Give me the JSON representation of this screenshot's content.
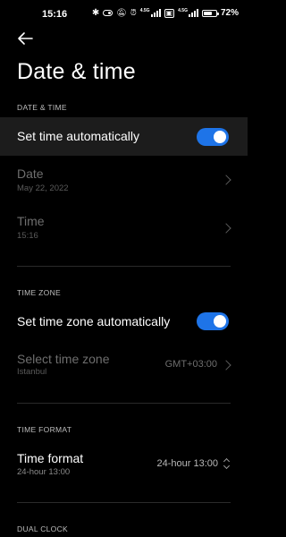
{
  "status_bar": {
    "time": "15:16",
    "network_label": "4.5G",
    "network_label2": "4.5G",
    "wifi_label": "WiFi",
    "battery_text": "72",
    "battery_level": 0.72
  },
  "header": {
    "title": "Date & time"
  },
  "date_time": {
    "section_label": "DATE & TIME",
    "set_automatically": {
      "label": "Set time automatically",
      "enabled": true
    },
    "date": {
      "label": "Date",
      "value": "May 22, 2022"
    },
    "time": {
      "label": "Time",
      "value": "15:16"
    }
  },
  "time_zone": {
    "section_label": "TIME ZONE",
    "set_automatically": {
      "label": "Set time zone automatically",
      "enabled": true
    },
    "select": {
      "label": "Select time zone",
      "sub": "Istanbul",
      "value": "GMT+03:00"
    }
  },
  "time_format": {
    "section_label": "TIME FORMAT",
    "row": {
      "label": "Time format",
      "sub": "24-hour 13:00",
      "value": "24-hour 13:00"
    }
  },
  "dual_clock": {
    "section_label": "DUAL CLOCK"
  },
  "colors": {
    "accent": "#1e74e8",
    "background": "#000000",
    "highlight_row": "#1c1c1c"
  }
}
